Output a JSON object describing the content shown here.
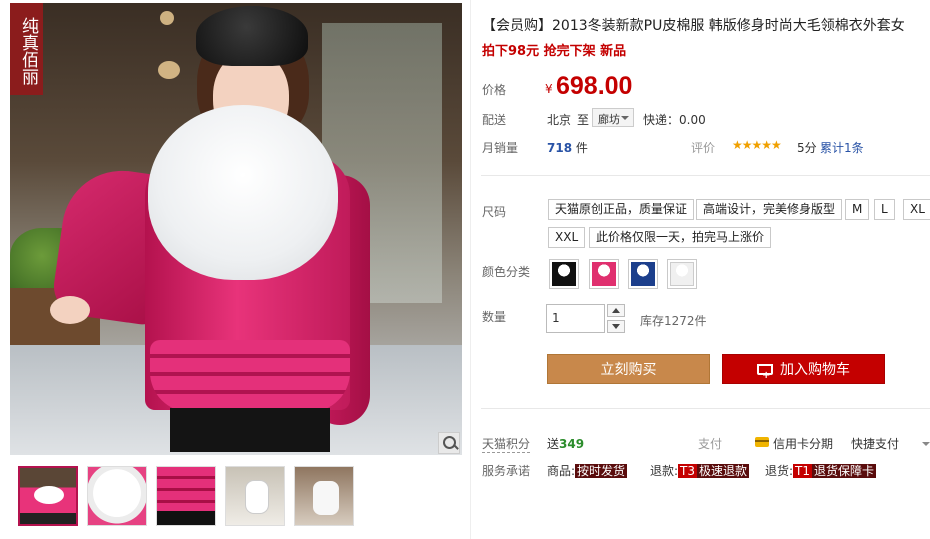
{
  "brand": {
    "tag_text": "纯真佰丽"
  },
  "gallery": {
    "thumbnails": [
      "thumb-1",
      "thumb-2",
      "thumb-3",
      "thumb-4",
      "thumb-5"
    ],
    "active_index": 0
  },
  "product": {
    "title": "【会员购】2013冬装新款PU皮棉服 韩版修身时尚大毛领棉衣外套女",
    "subtitle": "拍下98元 抢完下架 新品"
  },
  "price": {
    "label": "价格",
    "currency": "¥",
    "value": "698.00"
  },
  "shipping": {
    "label": "配送",
    "from": "北京",
    "to_word": "至",
    "city": "廊坊",
    "express": "快递：0.00"
  },
  "sales": {
    "label": "月销量",
    "count": "718",
    "unit": "件"
  },
  "review": {
    "label": "评价",
    "stars": "★★★★★",
    "score": "5分",
    "total": "累计1条"
  },
  "size": {
    "label": "尺码",
    "options": [
      "天猫原创正品，质量保证",
      "高端设计，完美修身版型",
      "M",
      "L",
      "XL",
      "XXL",
      "此价格仅限一天，拍完马上涨价"
    ]
  },
  "color": {
    "label": "颜色分类",
    "swatches": [
      "black",
      "rose-red",
      "blue",
      "white"
    ]
  },
  "quantity": {
    "label": "数量",
    "value": "1",
    "stock": "库存1272件"
  },
  "actions": {
    "buy_now": "立刻购买",
    "add_cart": "加入购物车"
  },
  "points": {
    "label": "天猫积分",
    "prefix": "送",
    "value": "349"
  },
  "payment": {
    "label": "支付",
    "credit": "信用卡分期",
    "quick": "快捷支付"
  },
  "service": {
    "label": "服务承诺",
    "goods_label": "商品:",
    "goods_tag": "按时发货",
    "refund_label": "退款:",
    "refund_badge": "T3",
    "refund_tag": "极速退款",
    "return_label": "退货:",
    "return_badge": "T1",
    "return_tag": "退货保障卡"
  }
}
